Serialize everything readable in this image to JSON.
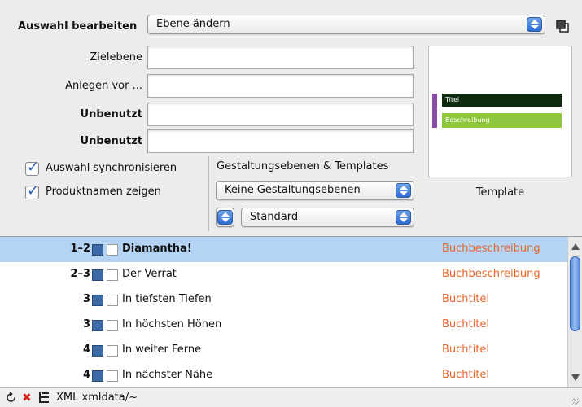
{
  "header": {
    "label": "Auswahl bearbeiten",
    "action_popup": "Ebene ändern",
    "copy_icon": "copy-icon"
  },
  "fields": [
    {
      "label": "Zielebene",
      "bold": false,
      "value": ""
    },
    {
      "label": "Anlegen vor ...",
      "bold": false,
      "value": ""
    },
    {
      "label": "Unbenutzt",
      "bold": true,
      "value": ""
    },
    {
      "label": "Unbenutzt",
      "bold": true,
      "value": ""
    }
  ],
  "options": {
    "sync_label": "Auswahl synchronisieren",
    "sync_checked": true,
    "product_names_label": "Produktnamen zeigen",
    "product_names_checked": true
  },
  "gestaltung": {
    "heading": "Gestaltungsebenen & Templates",
    "layers_popup": "Keine Gestaltungsebenen",
    "template_popup": "Standard"
  },
  "preview": {
    "title_text": "Titel",
    "desc_text": "Beschreibung",
    "caption": "Template",
    "colors": {
      "bar": "#8a4ca8",
      "title_bg": "#0f2a0f",
      "desc_bg": "#8fc63f"
    }
  },
  "list": {
    "type_color": "#e8652a",
    "selected_color": "#b5d3f3",
    "rows": [
      {
        "num": "1–2",
        "title": "Diamantha!",
        "type": "Buchbeschreibung",
        "selected": true
      },
      {
        "num": "2–3",
        "title": "Der Verrat",
        "type": "Buchbeschreibung",
        "selected": false
      },
      {
        "num": "3",
        "title": "In tiefsten Tiefen",
        "type": "Buchtitel",
        "selected": false
      },
      {
        "num": "3",
        "title": "In höchsten Höhen",
        "type": "Buchtitel",
        "selected": false
      },
      {
        "num": "4",
        "title": "In weiter Ferne",
        "type": "Buchtitel",
        "selected": false
      },
      {
        "num": "4",
        "title": "In nächster Nähe",
        "type": "Buchtitel",
        "selected": false
      }
    ]
  },
  "footer": {
    "path": "XML xmldata/~",
    "icons": [
      "refresh-icon",
      "delete-icon",
      "tree-icon"
    ]
  }
}
